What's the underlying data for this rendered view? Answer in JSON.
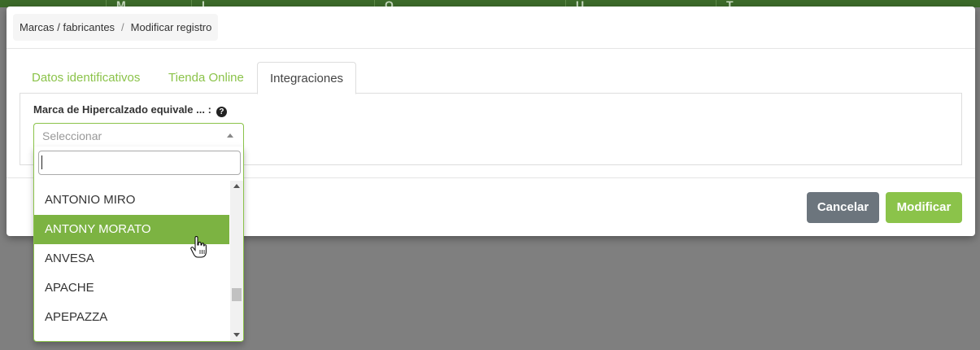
{
  "background_header": {
    "columns": [
      "M",
      "L",
      "O",
      "U",
      "T"
    ]
  },
  "breadcrumb": {
    "section": "Marcas / fabricantes",
    "separator": "/",
    "current": "Modificar registro"
  },
  "tabs": [
    {
      "label": "Datos identificativos",
      "active": false
    },
    {
      "label": "Tienda Online",
      "active": false
    },
    {
      "label": "Integraciones",
      "active": true
    }
  ],
  "field": {
    "label": "Marca de Hipercalzado equivale ... :",
    "help_icon": "question-circle-icon"
  },
  "select": {
    "placeholder": "Seleccionar",
    "search_value": ""
  },
  "dropdown": {
    "options": [
      "ANTONIO MIRO",
      "ANTONY MORATO",
      "ANVESA",
      "APACHE",
      "APEPAZZA"
    ],
    "highlighted": "ANTONY MORATO"
  },
  "footer": {
    "cancel_label": "Cancelar",
    "modify_label": "Modificar"
  },
  "colors": {
    "accent": "#8bc34a",
    "highlight": "#7cb342",
    "cancel": "#6c757d",
    "overlay": "#7f7f7f"
  }
}
